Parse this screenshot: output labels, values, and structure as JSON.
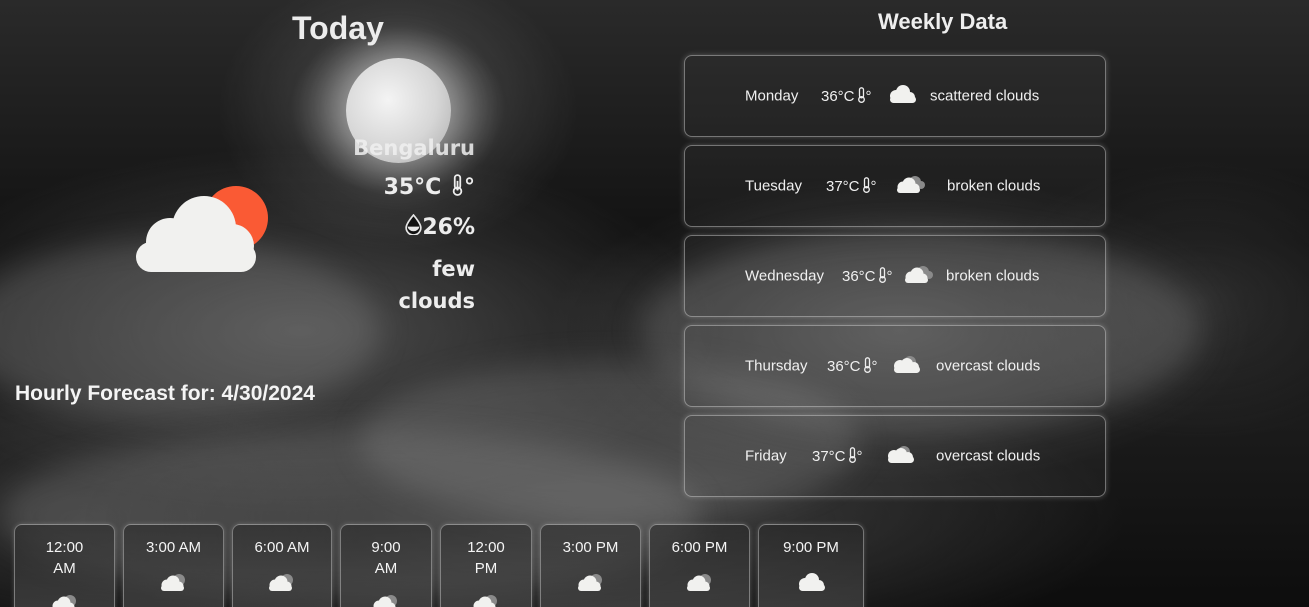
{
  "today": {
    "title": "Today",
    "city": "Bengaluru",
    "temperature": "35°C",
    "temp_icon": "thermometer-icon",
    "humidity": "26%",
    "humidity_icon": "droplet-icon",
    "description_line1": "few",
    "description_line2": "clouds",
    "weather_icon": "cloud-sun-icon"
  },
  "hourly": {
    "title": "Hourly Forecast for: 4/30/2024",
    "items": [
      {
        "line1": "12:00",
        "line2": "AM",
        "icon": "cloud-icon"
      },
      {
        "line1": "3:00 AM",
        "line2": "",
        "icon": "cloud-icon"
      },
      {
        "line1": "6:00 AM",
        "line2": "",
        "icon": "cloud-icon"
      },
      {
        "line1": "9:00",
        "line2": "AM",
        "icon": "cloud-icon"
      },
      {
        "line1": "12:00",
        "line2": "PM",
        "icon": "cloud-icon"
      },
      {
        "line1": "3:00 PM",
        "line2": "",
        "icon": "cloud-icon"
      },
      {
        "line1": "6:00 PM",
        "line2": "",
        "icon": "cloud-icon"
      },
      {
        "line1": "9:00 PM",
        "line2": "",
        "icon": "cloud-icon"
      }
    ]
  },
  "weekly": {
    "title": "Weekly Data",
    "days": [
      {
        "day": "Monday",
        "temp": "36°C",
        "condition": "scattered clouds"
      },
      {
        "day": "Tuesday",
        "temp": "37°C",
        "condition": "broken clouds"
      },
      {
        "day": "Wednesday",
        "temp": "36°C",
        "condition": "broken clouds"
      },
      {
        "day": "Thursday",
        "temp": "36°C",
        "condition": "overcast clouds"
      },
      {
        "day": "Friday",
        "temp": "37°C",
        "condition": "overcast clouds"
      }
    ]
  },
  "colors": {
    "sun": "#fa5a34",
    "cloud": "#f1f1ef",
    "text": "#f2f2f2"
  }
}
